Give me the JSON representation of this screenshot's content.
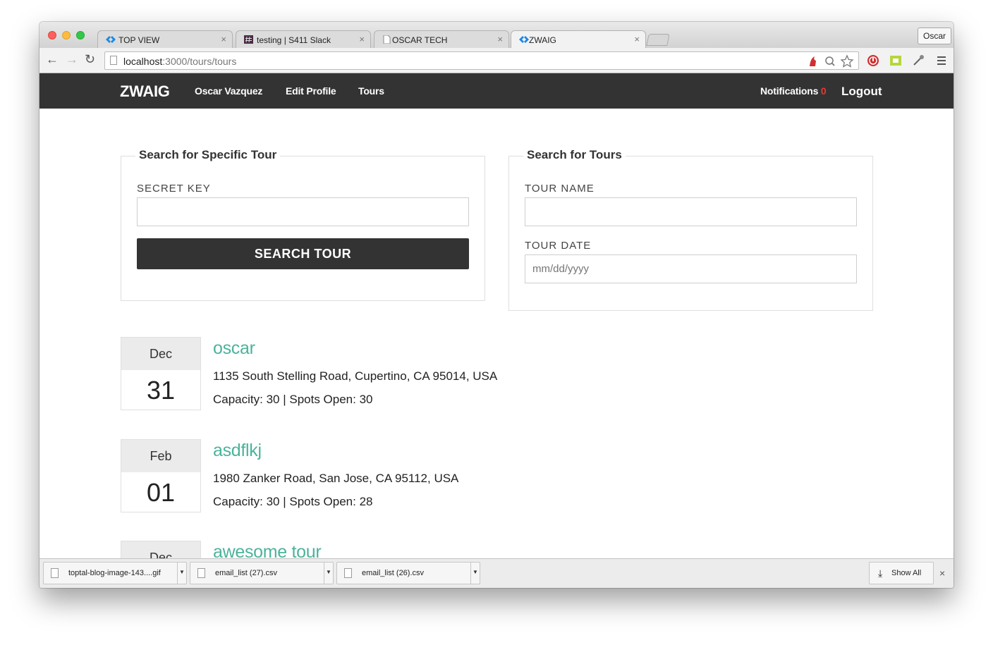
{
  "browser": {
    "tabs": [
      {
        "label": "TOP VIEW",
        "favicon": "diamond-icon",
        "active": false
      },
      {
        "label": "testing | S411 Slack",
        "favicon": "slack-hash-icon",
        "active": false
      },
      {
        "label": "OSCAR TECH",
        "favicon": "page-icon",
        "active": false
      },
      {
        "label": "ZWAIG",
        "favicon": "diamond-icon",
        "active": true
      }
    ],
    "tab_close_glyph": "×",
    "profile_name": "Oscar",
    "url_host": "localhost",
    "url_path": ":3000/tours/tours"
  },
  "app_nav": {
    "brand": "ZWAIG",
    "links": [
      "Oscar Vazquez",
      "Edit Profile",
      "Tours"
    ],
    "notifications_label": "Notifications",
    "notifications_count": "0",
    "logout": "Logout"
  },
  "specific_search": {
    "legend": "Search for Specific Tour",
    "secret_key_label": "SECRET KEY",
    "secret_key_value": "",
    "button_label": "SEARCH TOUR"
  },
  "tour_search": {
    "legend": "Search for Tours",
    "name_label": "TOUR NAME",
    "name_value": "",
    "date_label": "TOUR DATE",
    "date_placeholder": "mm/dd/yyyy"
  },
  "tours": [
    {
      "month": "Dec",
      "day": "31",
      "name": "oscar",
      "address": "1135 South Stelling Road, Cupertino, CA 95014, USA",
      "meta": "Capacity: 30  |  Spots Open: 30"
    },
    {
      "month": "Feb",
      "day": "01",
      "name": "asdflkj",
      "address": "1980 Zanker Road, San Jose, CA 95112, USA",
      "meta": "Capacity: 30  |  Spots Open: 28"
    },
    {
      "month": "Dec",
      "day": "",
      "name": "awesome tour",
      "address": "",
      "meta": ""
    }
  ],
  "downloads": {
    "items": [
      {
        "name": "toptal-blog-image-143....gif"
      },
      {
        "name": "email_list (27).csv"
      },
      {
        "name": "email_list (26).csv"
      }
    ],
    "show_all": "Show All",
    "close_glyph": "×"
  },
  "colors": {
    "navbar": "#333333",
    "accent": "#4bb39c",
    "notification": "#e53935"
  }
}
